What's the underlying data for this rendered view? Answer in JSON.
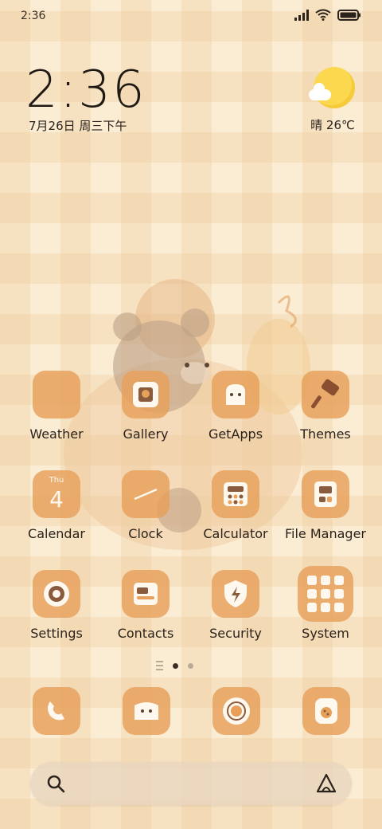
{
  "status_bar": {
    "time": "2:36",
    "icons": [
      "signal-icon",
      "wifi-icon",
      "battery-icon"
    ]
  },
  "clock_widget": {
    "time": "2:36",
    "date": "7月26日 周三下午"
  },
  "weather_widget": {
    "condition": "晴",
    "temperature": "26℃",
    "text": "晴 26℃",
    "icon": "sun-cloud-icon"
  },
  "apps": [
    {
      "label": "Weather",
      "icon": "weather-icon"
    },
    {
      "label": "Gallery",
      "icon": "gallery-icon"
    },
    {
      "label": "GetApps",
      "icon": "getapps-icon"
    },
    {
      "label": "Themes",
      "icon": "themes-icon"
    },
    {
      "label": "Calendar",
      "icon": "calendar-icon",
      "day_name": "Thu",
      "day_number": "4"
    },
    {
      "label": "Clock",
      "icon": "clock-icon"
    },
    {
      "label": "Calculator",
      "icon": "calculator-icon"
    },
    {
      "label": "File Manager",
      "icon": "file-manager-icon"
    },
    {
      "label": "Settings",
      "icon": "settings-icon"
    },
    {
      "label": "Contacts",
      "icon": "contacts-icon"
    },
    {
      "label": "Security",
      "icon": "security-icon"
    },
    {
      "label": "System",
      "icon": "system-folder-icon"
    }
  ],
  "page_indicator": {
    "pages": 2,
    "active": 1
  },
  "dock": [
    {
      "icon": "phone-icon"
    },
    {
      "icon": "messages-icon"
    },
    {
      "icon": "camera-icon"
    },
    {
      "icon": "browser-icon"
    }
  ],
  "search_bar": {
    "left_icon": "search-icon",
    "right_icon": "assistant-icon"
  },
  "colors": {
    "tile": "#e6a05a",
    "tile_inner": "#fff8ee",
    "sun": "#fcd84e",
    "text": "#2a221b"
  }
}
